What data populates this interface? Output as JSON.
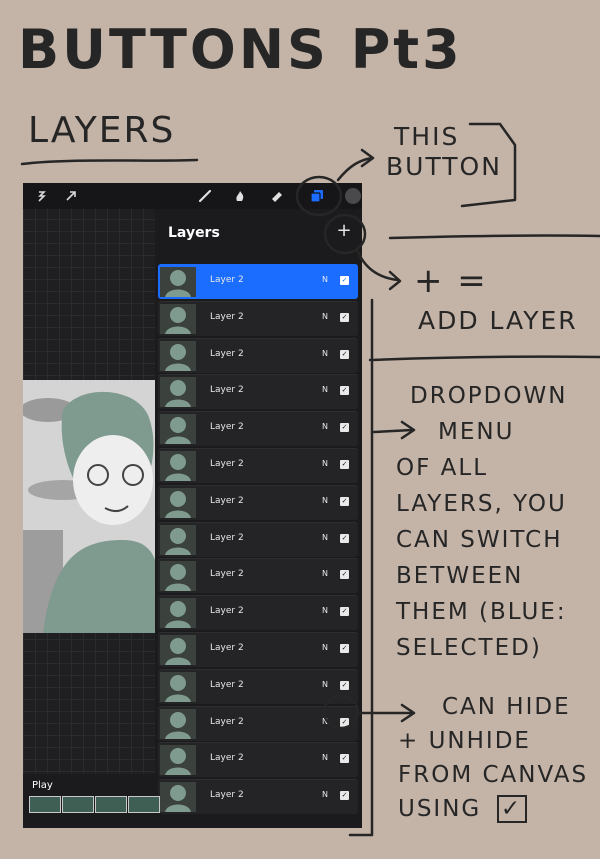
{
  "title": "BUTTONS Pt3",
  "subtitle": "LAYERS",
  "app": {
    "toolbar": {
      "left_icons": [
        "selection-icon",
        "transform-arrow-icon"
      ],
      "right_icons": [
        "brush-icon",
        "smudge-icon",
        "eraser-icon",
        "layers-icon",
        "color-swatch-icon"
      ]
    },
    "layers_panel": {
      "header": "Layers",
      "add_symbol": "+",
      "layers": [
        {
          "name": "Layer 2",
          "blend": "N",
          "visible": true,
          "selected": true
        },
        {
          "name": "Layer 2",
          "blend": "N",
          "visible": true,
          "selected": false
        },
        {
          "name": "Layer 2",
          "blend": "N",
          "visible": true,
          "selected": false
        },
        {
          "name": "Layer 2",
          "blend": "N",
          "visible": true,
          "selected": false
        },
        {
          "name": "Layer 2",
          "blend": "N",
          "visible": true,
          "selected": false
        },
        {
          "name": "Layer 2",
          "blend": "N",
          "visible": true,
          "selected": false
        },
        {
          "name": "Layer 2",
          "blend": "N",
          "visible": true,
          "selected": false
        },
        {
          "name": "Layer 2",
          "blend": "N",
          "visible": true,
          "selected": false
        },
        {
          "name": "Layer 2",
          "blend": "N",
          "visible": true,
          "selected": false
        },
        {
          "name": "Layer 2",
          "blend": "N",
          "visible": true,
          "selected": false
        },
        {
          "name": "Layer 2",
          "blend": "N",
          "visible": true,
          "selected": false
        },
        {
          "name": "Layer 2",
          "blend": "N",
          "visible": true,
          "selected": false
        },
        {
          "name": "Layer 2",
          "blend": "N",
          "visible": true,
          "selected": false
        },
        {
          "name": "Layer 2",
          "blend": "N",
          "visible": true,
          "selected": false
        },
        {
          "name": "Layer 2",
          "blend": "N",
          "visible": true,
          "selected": false
        }
      ]
    },
    "animation": {
      "play_label": "Play",
      "frame_count": 4
    }
  },
  "annotations": {
    "this_button": [
      "THIS",
      "BUTTON"
    ],
    "add_layer_symbol": "+ =",
    "add_layer": "ADD LAYER",
    "dropdown": [
      "DROPDOWN",
      "MENU",
      "OF ALL",
      "LAYERS, YOU",
      "CAN SWITCH",
      "BETWEEN",
      "THEM (BLUE:",
      "SELECTED)"
    ],
    "hide": [
      "CAN HIDE",
      "+ UNHIDE",
      "FROM CANVAS",
      "USING"
    ],
    "check_symbol": "✓"
  },
  "colors": {
    "background": "#c4b3a7",
    "ink": "#262626",
    "selected_layer": "#1a6dff",
    "panel": "#1b1b1d"
  }
}
